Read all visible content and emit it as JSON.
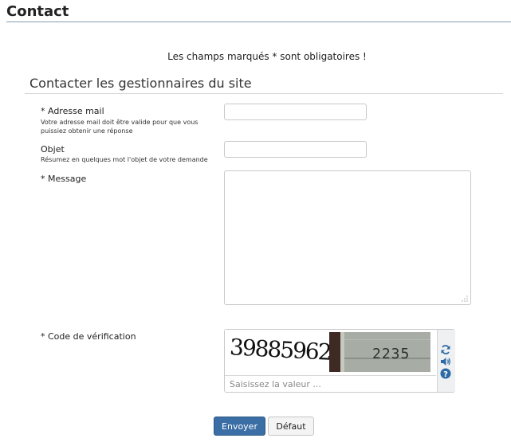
{
  "page": {
    "title": "Contact"
  },
  "form": {
    "required_note": "Les champs marqués * sont obligatoires !",
    "legend": "Contacter les gestionnaires du site",
    "email": {
      "label": "* Adresse mail",
      "hint": "Votre adresse mail doit être valide pour que vous puissiez obtenir une réponse",
      "value": ""
    },
    "subject": {
      "label": "Objet",
      "hint": "Résumez en quelques mot l'objet de votre demande",
      "value": ""
    },
    "message": {
      "label": "* Message",
      "value": ""
    },
    "captcha": {
      "label": "* Code de vérification",
      "image_text_1": "39885962",
      "image_text_2": "2235",
      "placeholder": "Saisissez la valeur ...",
      "icons": [
        "refresh-icon",
        "audio-icon",
        "help-icon"
      ]
    },
    "buttons": {
      "submit": "Envoyer",
      "reset": "Défaut"
    }
  },
  "colors": {
    "primary_button": "#3a6ea5",
    "title_rule": "#7f9fb4",
    "captcha_icon": "#2e6aa6"
  }
}
